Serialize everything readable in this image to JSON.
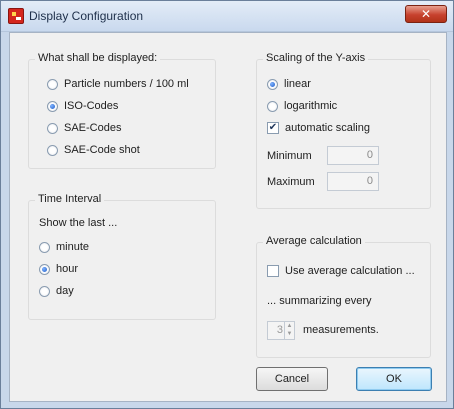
{
  "window": {
    "title": "Display Configuration",
    "close_glyph": "✕"
  },
  "display_group": {
    "legend": "What shall be displayed:",
    "options": [
      {
        "label": "Particle numbers / 100 ml",
        "selected": false
      },
      {
        "label": "ISO-Codes",
        "selected": true
      },
      {
        "label": "SAE-Codes",
        "selected": false
      },
      {
        "label": "SAE-Code shot",
        "selected": false
      }
    ]
  },
  "time_group": {
    "legend": "Time Interval",
    "intro": "Show the last ...",
    "options": [
      {
        "label": "minute",
        "selected": false
      },
      {
        "label": "hour",
        "selected": true
      },
      {
        "label": "day",
        "selected": false
      }
    ]
  },
  "scaling_group": {
    "legend": "Scaling of the Y-axis",
    "options": [
      {
        "label": "linear",
        "selected": true
      },
      {
        "label": "logarithmic",
        "selected": false
      }
    ],
    "automatic_scaling": {
      "label": "automatic scaling",
      "checked": true,
      "check_glyph": "✔"
    },
    "minimum": {
      "label": "Minimum",
      "value": "0"
    },
    "maximum": {
      "label": "Maximum",
      "value": "0"
    }
  },
  "average_group": {
    "legend": "Average calculation",
    "use_average": {
      "label": "Use average calculation ...",
      "checked": false
    },
    "summarizing_text": "... summarizing every",
    "measurements": {
      "value": "3",
      "label": "measurements.",
      "up_glyph": "▲",
      "down_glyph": "▼"
    }
  },
  "buttons": {
    "cancel": "Cancel",
    "ok": "OK"
  },
  "colors": {
    "title_bar": "#c9d9ee",
    "close_button": "#c7422e",
    "dialog_bg": "#f0f0f0",
    "radio_selected": "#1e5bc6"
  }
}
